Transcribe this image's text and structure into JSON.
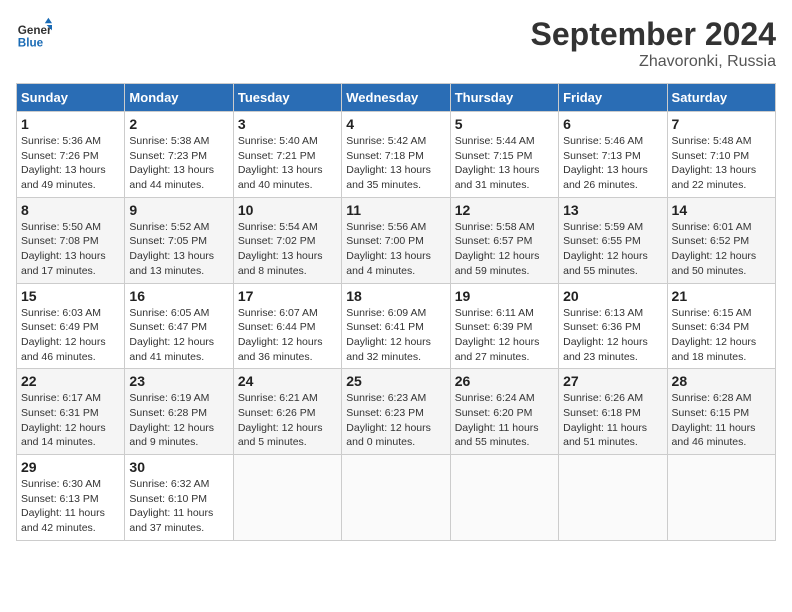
{
  "header": {
    "logo_line1": "General",
    "logo_line2": "Blue",
    "month_title": "September 2024",
    "location": "Zhavoronki, Russia"
  },
  "days_of_week": [
    "Sunday",
    "Monday",
    "Tuesday",
    "Wednesday",
    "Thursday",
    "Friday",
    "Saturday"
  ],
  "weeks": [
    [
      {
        "num": "1",
        "detail": "Sunrise: 5:36 AM\nSunset: 7:26 PM\nDaylight: 13 hours\nand 49 minutes."
      },
      {
        "num": "2",
        "detail": "Sunrise: 5:38 AM\nSunset: 7:23 PM\nDaylight: 13 hours\nand 44 minutes."
      },
      {
        "num": "3",
        "detail": "Sunrise: 5:40 AM\nSunset: 7:21 PM\nDaylight: 13 hours\nand 40 minutes."
      },
      {
        "num": "4",
        "detail": "Sunrise: 5:42 AM\nSunset: 7:18 PM\nDaylight: 13 hours\nand 35 minutes."
      },
      {
        "num": "5",
        "detail": "Sunrise: 5:44 AM\nSunset: 7:15 PM\nDaylight: 13 hours\nand 31 minutes."
      },
      {
        "num": "6",
        "detail": "Sunrise: 5:46 AM\nSunset: 7:13 PM\nDaylight: 13 hours\nand 26 minutes."
      },
      {
        "num": "7",
        "detail": "Sunrise: 5:48 AM\nSunset: 7:10 PM\nDaylight: 13 hours\nand 22 minutes."
      }
    ],
    [
      {
        "num": "8",
        "detail": "Sunrise: 5:50 AM\nSunset: 7:08 PM\nDaylight: 13 hours\nand 17 minutes."
      },
      {
        "num": "9",
        "detail": "Sunrise: 5:52 AM\nSunset: 7:05 PM\nDaylight: 13 hours\nand 13 minutes."
      },
      {
        "num": "10",
        "detail": "Sunrise: 5:54 AM\nSunset: 7:02 PM\nDaylight: 13 hours\nand 8 minutes."
      },
      {
        "num": "11",
        "detail": "Sunrise: 5:56 AM\nSunset: 7:00 PM\nDaylight: 13 hours\nand 4 minutes."
      },
      {
        "num": "12",
        "detail": "Sunrise: 5:58 AM\nSunset: 6:57 PM\nDaylight: 12 hours\nand 59 minutes."
      },
      {
        "num": "13",
        "detail": "Sunrise: 5:59 AM\nSunset: 6:55 PM\nDaylight: 12 hours\nand 55 minutes."
      },
      {
        "num": "14",
        "detail": "Sunrise: 6:01 AM\nSunset: 6:52 PM\nDaylight: 12 hours\nand 50 minutes."
      }
    ],
    [
      {
        "num": "15",
        "detail": "Sunrise: 6:03 AM\nSunset: 6:49 PM\nDaylight: 12 hours\nand 46 minutes."
      },
      {
        "num": "16",
        "detail": "Sunrise: 6:05 AM\nSunset: 6:47 PM\nDaylight: 12 hours\nand 41 minutes."
      },
      {
        "num": "17",
        "detail": "Sunrise: 6:07 AM\nSunset: 6:44 PM\nDaylight: 12 hours\nand 36 minutes."
      },
      {
        "num": "18",
        "detail": "Sunrise: 6:09 AM\nSunset: 6:41 PM\nDaylight: 12 hours\nand 32 minutes."
      },
      {
        "num": "19",
        "detail": "Sunrise: 6:11 AM\nSunset: 6:39 PM\nDaylight: 12 hours\nand 27 minutes."
      },
      {
        "num": "20",
        "detail": "Sunrise: 6:13 AM\nSunset: 6:36 PM\nDaylight: 12 hours\nand 23 minutes."
      },
      {
        "num": "21",
        "detail": "Sunrise: 6:15 AM\nSunset: 6:34 PM\nDaylight: 12 hours\nand 18 minutes."
      }
    ],
    [
      {
        "num": "22",
        "detail": "Sunrise: 6:17 AM\nSunset: 6:31 PM\nDaylight: 12 hours\nand 14 minutes."
      },
      {
        "num": "23",
        "detail": "Sunrise: 6:19 AM\nSunset: 6:28 PM\nDaylight: 12 hours\nand 9 minutes."
      },
      {
        "num": "24",
        "detail": "Sunrise: 6:21 AM\nSunset: 6:26 PM\nDaylight: 12 hours\nand 5 minutes."
      },
      {
        "num": "25",
        "detail": "Sunrise: 6:23 AM\nSunset: 6:23 PM\nDaylight: 12 hours\nand 0 minutes."
      },
      {
        "num": "26",
        "detail": "Sunrise: 6:24 AM\nSunset: 6:20 PM\nDaylight: 11 hours\nand 55 minutes."
      },
      {
        "num": "27",
        "detail": "Sunrise: 6:26 AM\nSunset: 6:18 PM\nDaylight: 11 hours\nand 51 minutes."
      },
      {
        "num": "28",
        "detail": "Sunrise: 6:28 AM\nSunset: 6:15 PM\nDaylight: 11 hours\nand 46 minutes."
      }
    ],
    [
      {
        "num": "29",
        "detail": "Sunrise: 6:30 AM\nSunset: 6:13 PM\nDaylight: 11 hours\nand 42 minutes."
      },
      {
        "num": "30",
        "detail": "Sunrise: 6:32 AM\nSunset: 6:10 PM\nDaylight: 11 hours\nand 37 minutes."
      },
      {
        "num": "",
        "detail": ""
      },
      {
        "num": "",
        "detail": ""
      },
      {
        "num": "",
        "detail": ""
      },
      {
        "num": "",
        "detail": ""
      },
      {
        "num": "",
        "detail": ""
      }
    ]
  ]
}
